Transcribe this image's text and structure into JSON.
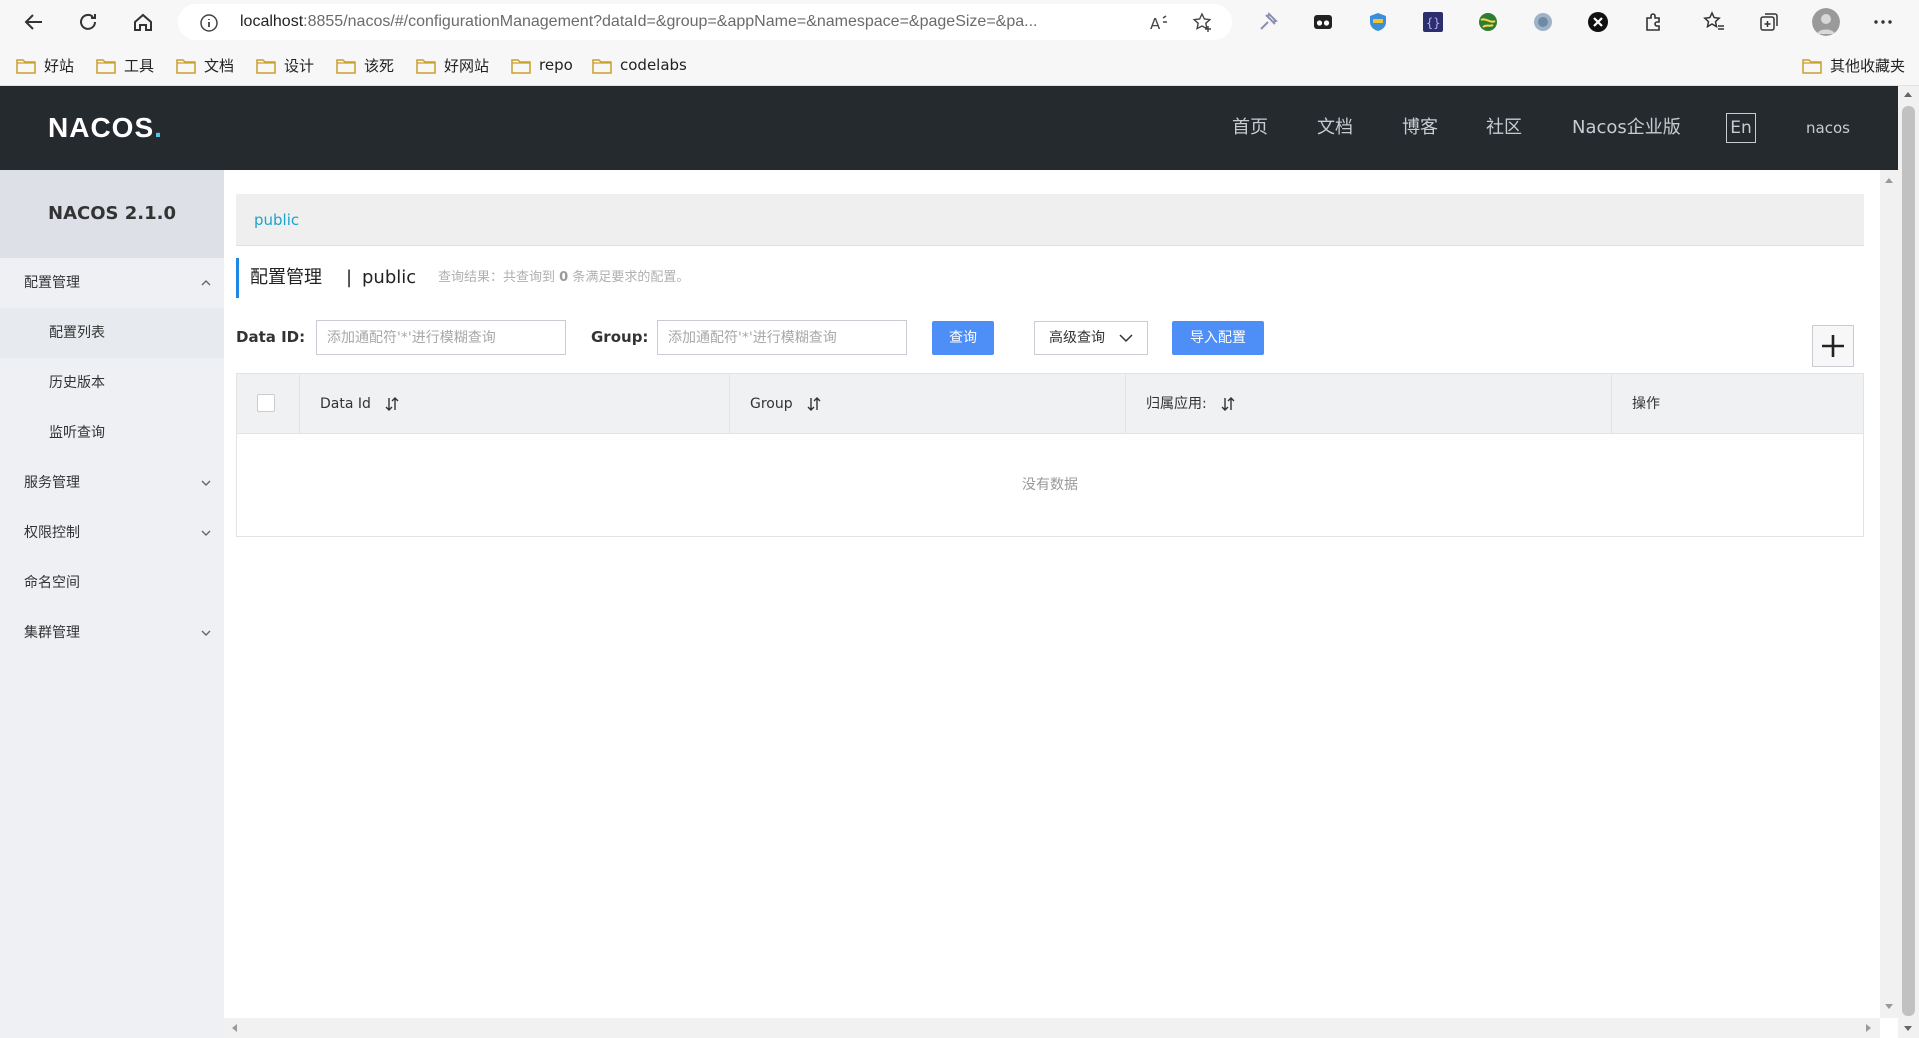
{
  "browser": {
    "url_host": "localhost",
    "url_rest": ":8855/nacos/#/configurationManagement?dataId=&group=&appName=&namespace=&pageSize=&pa...",
    "bookmarks": [
      "好站",
      "工具",
      "文档",
      "设计",
      "该死",
      "好网站",
      "repo",
      "codelabs"
    ],
    "other_bookmarks": "其他收藏夹"
  },
  "header": {
    "logo_main": "NACOS",
    "logo_dot": ".",
    "nav": [
      "首页",
      "文档",
      "博客",
      "社区",
      "Nacos企业版"
    ],
    "lang": "En",
    "user": "nacos"
  },
  "sidebar": {
    "version": "NACOS 2.1.0",
    "items": [
      {
        "label": "配置管理"
      },
      {
        "label": "配置列表"
      },
      {
        "label": "历史版本"
      },
      {
        "label": "监听查询"
      },
      {
        "label": "服务管理"
      },
      {
        "label": "权限控制"
      },
      {
        "label": "命名空间"
      },
      {
        "label": "集群管理"
      }
    ]
  },
  "main": {
    "namespace_link": "public",
    "title": "配置管理",
    "title_sep": "|",
    "title_ns": "public",
    "query_result_prefix": "查询结果：共查询到",
    "query_result_count": "0",
    "query_result_suffix": "条满足要求的配置。",
    "filters": {
      "data_id_label": "Data ID:",
      "data_id_placeholder": "添加通配符'*'进行模糊查询",
      "group_label": "Group:",
      "group_placeholder": "添加通配符'*'进行模糊查询",
      "search_label": "查询",
      "advanced_label": "高级查询",
      "import_label": "导入配置"
    },
    "table": {
      "columns": [
        "Data Id",
        "Group",
        "归属应用:",
        "操作"
      ],
      "empty_text": "没有数据"
    }
  },
  "colors": {
    "header_bg": "#252a2f",
    "primary": "#4e8ef7",
    "accent": "#1ea4c8",
    "sidebar_bg": "#eef0f4"
  }
}
